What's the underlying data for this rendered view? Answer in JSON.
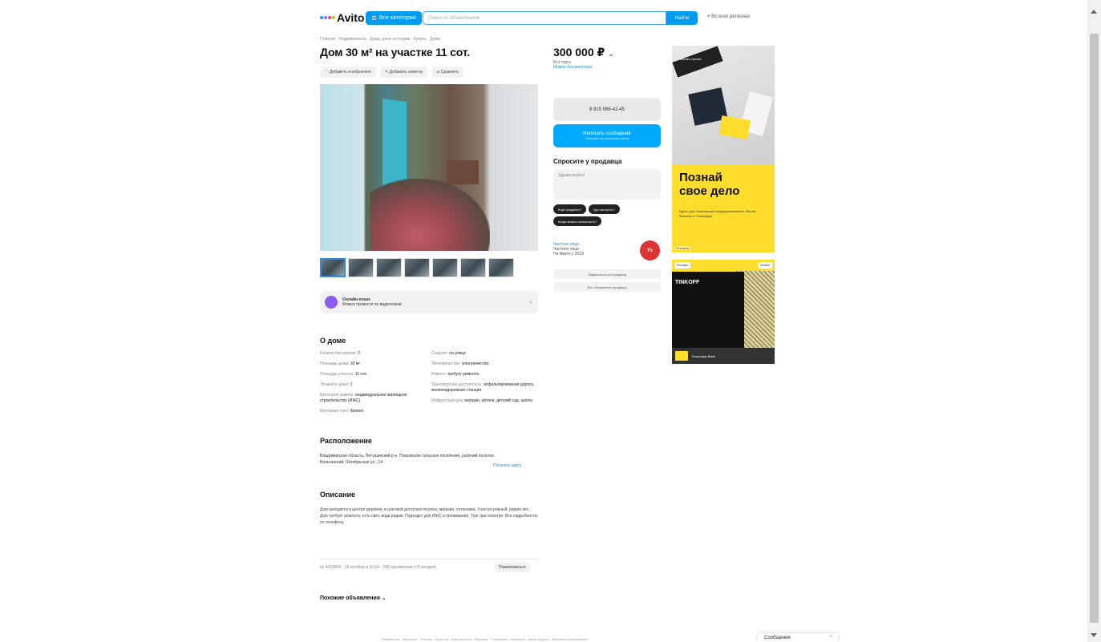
{
  "header": {
    "logo": "Avito",
    "logo_colors": [
      "#0af",
      "#a168f7",
      "#ff4053",
      "#97cf26"
    ],
    "categories_label": "Все категории",
    "search_placeholder": "Поиск по объявлениям",
    "find_label": "Найти",
    "region": "Во всех регионах"
  },
  "breadcrumbs": "Главная · Недвижимость · Дома, дачи, коттеджи · Купить · Дома",
  "listing": {
    "title": "Дом 30 м² на участке 11 сот.",
    "actions": [
      "Добавить в избранное",
      "Добавить заметку",
      "Сравнить"
    ],
    "virtual_tour_title": "Онлайн-показ",
    "virtual_tour_sub": "Можно провести по видеосвязи",
    "thumb_count": 7
  },
  "about": {
    "title": "О доме",
    "left": [
      {
        "label": "Количество комнат:",
        "value": "2"
      },
      {
        "label": "Площадь дома:",
        "value": "30 м²"
      },
      {
        "label": "Площадь участка:",
        "value": "11 сот."
      },
      {
        "label": "Этажей в доме:",
        "value": "1"
      },
      {
        "label": "Категория земель:",
        "value": "индивидуальное жилищное строительство (ИЖС)"
      },
      {
        "label": "Материал стен:",
        "value": "бревно"
      }
    ],
    "right": [
      {
        "label": "Санузел:",
        "value": "на улице"
      },
      {
        "label": "Электричество:",
        "value": "электричество"
      },
      {
        "label": "Ремонт:",
        "value": "требует ремонта"
      },
      {
        "label": "Транспортная доступность:",
        "value": "асфальтированная дорога, железнодорожная станция"
      },
      {
        "label": "Инфраструктура:",
        "value": "магазин, аптека, детский сад, школа"
      }
    ]
  },
  "location": {
    "title": "Расположение",
    "address": "Владимирская область, Петушинский р-н, Покровское сельское поселение, рабочий посёлок, Вольгинский, Октябрьская ул., 14",
    "map_link": "Показать карту"
  },
  "description": {
    "title": "Описание",
    "text": "Дом находится в центре деревни, в шаговой доступности река, магазин, остановка. Участок ровный, рядом лес. Дом требует ремонта, есть свет, вода рядом. Подходит для ИЖС и проживания. Торг при осмотре. Все подробности по телефону."
  },
  "footer_meta": {
    "info": "№ 4418000 · 18 октября в 10:14 · 245 просмотров (+3 сегодня)",
    "complain": "Пожаловаться",
    "similar": "Похожие объявления"
  },
  "sidebar": {
    "price": "300 000 ₽",
    "price_sub1": "Без торга",
    "price_sub2": "Можно без риелтора",
    "phone": "8 915 986-42-45",
    "message_title": "Написать сообщение",
    "message_sub": "Отвечает за несколько часов",
    "ask_title": "Спросите у продавца",
    "ask_placeholder": "Здравствуйте!",
    "chips": [
      "Ещё продаёте?",
      "Где смотреть?",
      "Когда можно посмотреть?"
    ],
    "seller_name": "Частное лицо",
    "seller_type": "Частное лицо",
    "seller_since": "На Авито с 2019",
    "avatar_label": "Уз",
    "subscribe": "Подписаться на продавца",
    "all_ads": "Все объявления продавца"
  },
  "ads": {
    "ad1_brand": "Бизнес Школа",
    "ad1_headline_1": "Познай",
    "ad1_headline_2": "свое дело",
    "ad1_small": "Курсы для начинающих предпринимателей. Школа бизнеса от Тинькофф",
    "ad1_tag": "Реклама",
    "ad2_card": "TINKOFF",
    "ad2_pill_left": "Реклама",
    "ad2_pill_right": "Кэшбэк",
    "ad2_foot": "Тинькофф Black"
  },
  "bottom": {
    "links": "Объявления · Магазины · Помощь · Каталоги · Безопасность · Реклама · О компании · Вакансии · Авито Журнал · Мобильное приложение",
    "messages": "Сообщения"
  }
}
